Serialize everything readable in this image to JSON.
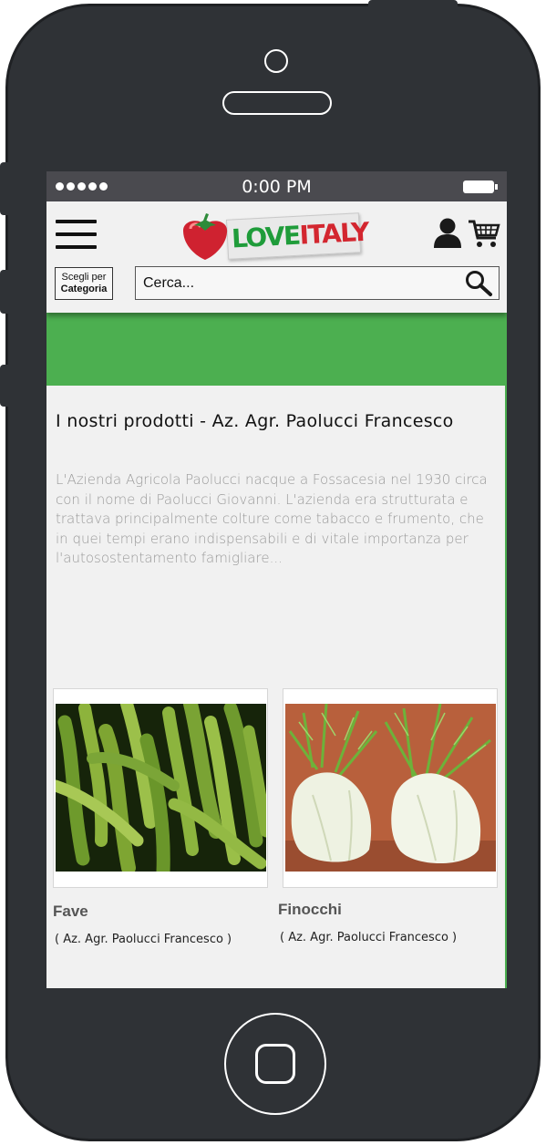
{
  "status_bar": {
    "time": "0:00 PM"
  },
  "header": {
    "logo": {
      "love": "LOVE",
      "italy": "ITALY"
    },
    "category_button": {
      "line1": "Scegli per",
      "line2": "Categoria"
    },
    "search": {
      "placeholder": "Cerca..."
    }
  },
  "colors": {
    "banner": "#4caf50",
    "logo_green": "#1f9c3a",
    "logo_red": "#d3262f",
    "phone_body": "#2f3236"
  },
  "main": {
    "title": "I nostri prodotti - Az. Agr. Paolucci Francesco",
    "description": "L'Azienda Agricola Paolucci nacque a Fossacesia nel 1930 circa con il nome di Paolucci Giovanni. L'azienda era strutturata e trattava principalmente colture come tabacco e frumento, che in quei tempi erano indispensabili e di vitale importanza per l'autosostentamento famigliare...",
    "products": [
      {
        "name": "Fave",
        "producer": "( Az. Agr. Paolucci Francesco )",
        "image_icon": "fava-beans-image"
      },
      {
        "name": "Finocchi",
        "producer": "( Az. Agr. Paolucci Francesco )",
        "image_icon": "fennel-image"
      }
    ]
  }
}
